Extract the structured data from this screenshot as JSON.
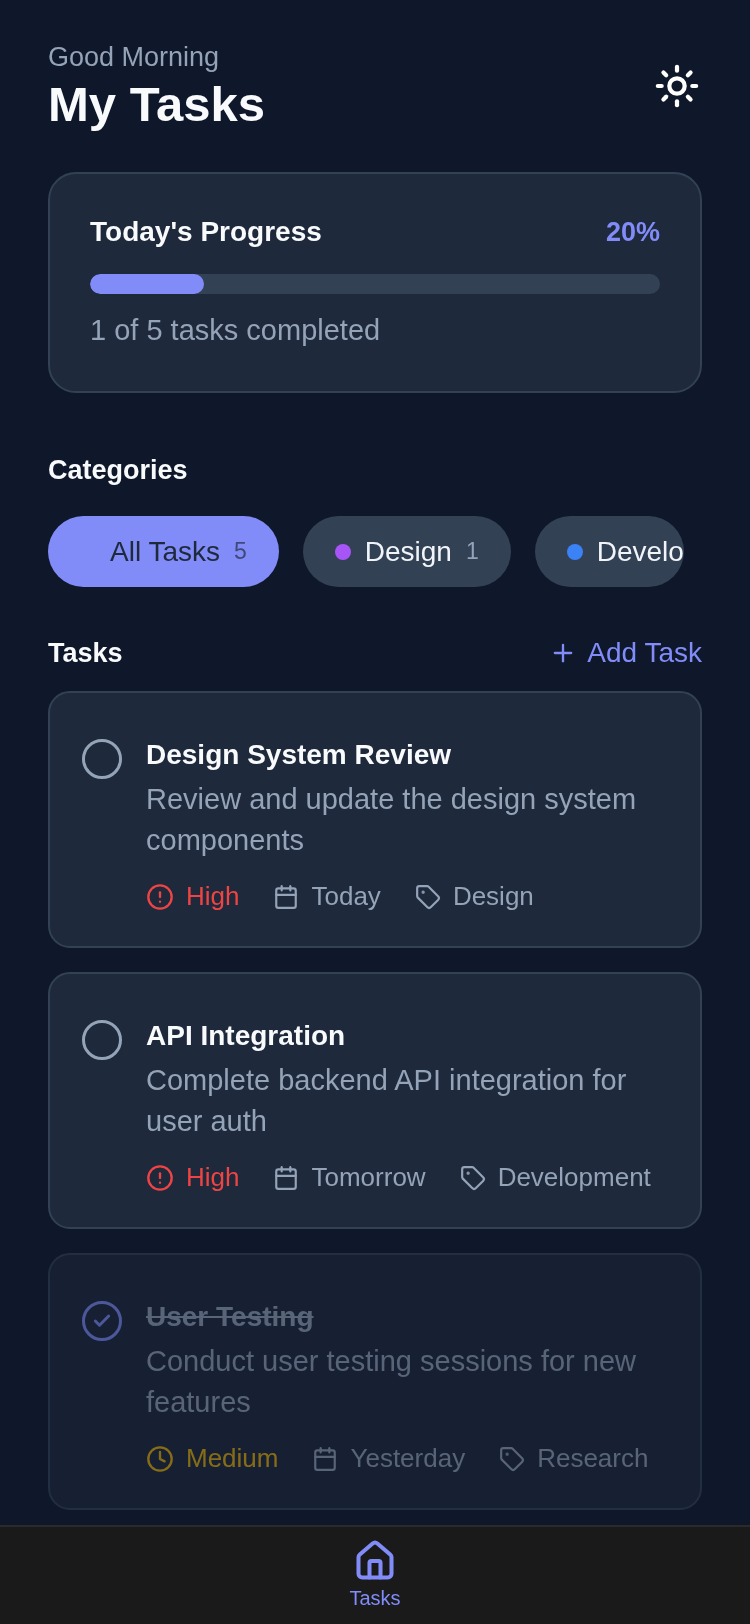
{
  "header": {
    "greeting": "Good Morning",
    "title": "My Tasks"
  },
  "progress": {
    "title": "Today's Progress",
    "percent": "20%",
    "level": 0.2,
    "summary": "1 of 5 tasks completed"
  },
  "categories": {
    "title": "Categories",
    "items": [
      {
        "label": "All Tasks",
        "count": "5",
        "selected": true
      },
      {
        "label": "Design",
        "count": "1",
        "selected": false,
        "color": "#a855f7"
      },
      {
        "label": "Develo",
        "selected": false,
        "color": "#3b82f6"
      }
    ]
  },
  "tasks": {
    "title": "Tasks",
    "add_label": "Add Task",
    "items": [
      {
        "title": "Design System Review",
        "description": "Review and update the design system components",
        "priority": "High",
        "kind": "high",
        "date": "Today",
        "category": "Design",
        "completed": false
      },
      {
        "title": "API Integration",
        "description": "Complete backend API integration for user auth",
        "priority": "High",
        "kind": "high",
        "date": "Tomorrow",
        "category": "Development",
        "completed": false
      },
      {
        "title": "User Testing",
        "description": "Conduct user testing sessions for new features",
        "priority": "Medium",
        "kind": "medium",
        "date": "Yesterday",
        "category": "Research",
        "completed": true
      }
    ]
  },
  "tab_bar": [
    {
      "label": "Tasks",
      "selected": true
    }
  ]
}
